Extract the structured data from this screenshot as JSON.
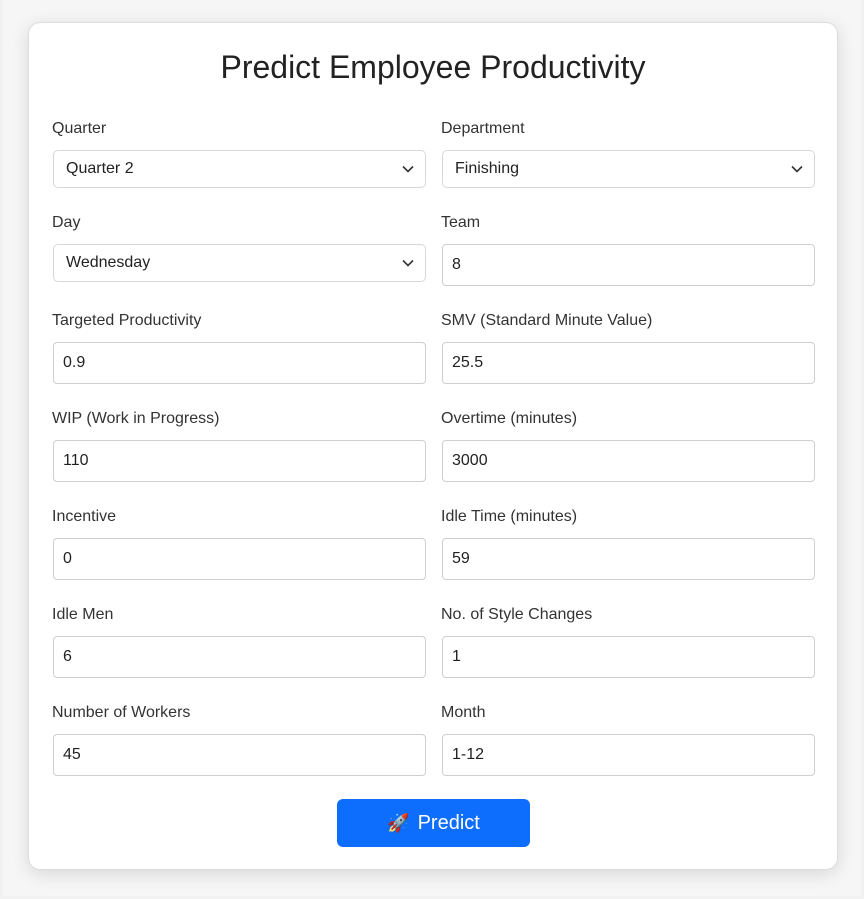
{
  "form": {
    "title": "Predict Employee Productivity",
    "fields": {
      "quarter": {
        "label": "Quarter",
        "value": "Quarter 2"
      },
      "department": {
        "label": "Department",
        "value": "Finishing"
      },
      "day": {
        "label": "Day",
        "value": "Wednesday"
      },
      "team": {
        "label": "Team",
        "value": "8"
      },
      "targeted_productivity": {
        "label": "Targeted Productivity",
        "value": "0.9"
      },
      "smv": {
        "label": "SMV (Standard Minute Value)",
        "value": "25.5"
      },
      "wip": {
        "label": "WIP (Work in Progress)",
        "value": "110"
      },
      "overtime": {
        "label": "Overtime (minutes)",
        "value": "3000"
      },
      "incentive": {
        "label": "Incentive",
        "value": "0"
      },
      "idle_time": {
        "label": "Idle Time (minutes)",
        "value": "59"
      },
      "idle_men": {
        "label": "Idle Men",
        "value": "6"
      },
      "style_changes": {
        "label": "No. of Style Changes",
        "value": "1"
      },
      "workers": {
        "label": "Number of Workers",
        "value": "45"
      },
      "month": {
        "label": "Month",
        "value": "1-12"
      }
    },
    "predict_label": "Predict",
    "predict_icon": "rocket-icon",
    "accent_color": "#0d6efd"
  }
}
